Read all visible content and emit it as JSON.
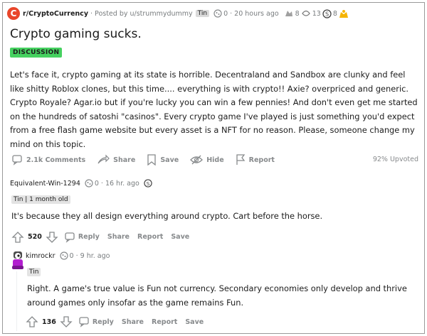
{
  "post": {
    "subreddit": "r/CryptoCurrency",
    "posted_by": "· Posted by u/strummydummy",
    "user_flair": "Tin",
    "moon_count": "0",
    "time": "· 20 hours ago",
    "award1_count": "8",
    "award2_count": "13",
    "award3_count": "8",
    "title": "Crypto gaming sucks.",
    "tag": "DISCUSSION",
    "body": "Let's face it, crypto gaming at its state is horrible. Decentraland and Sandbox are clunky and feel like shitty Roblox clones, but this time.... everything is with crypto!! Axie? overpriced and generic. Crypto Royale? Agar.io but if you're lucky you can win a few pennies! And don't even get me started on the hundreds of satoshi \"casinos\". Every crypto game I've played is just something you'd expect from a free flash game website but every asset is a NFT for no reason. Please, someone change my mind on this topic.",
    "actions": {
      "comments": "2.1k Comments",
      "share": "Share",
      "save": "Save",
      "hide": "Hide",
      "report": "Report",
      "upvoted": "92% Upvoted"
    }
  },
  "comments": [
    {
      "author": "Equivalent-Win-1294",
      "moon_count": "0",
      "time": "· 16 hr. ago",
      "flair": "Tin | 1 month old",
      "text": "It's because they all design everything around crypto. Cart before the horse.",
      "votes": "520",
      "reply": "Reply",
      "share": "Share",
      "report": "Report",
      "save": "Save"
    },
    {
      "author": "kimrockr",
      "moon_count": "0",
      "time": "· 9 hr. ago",
      "flair": "Tin",
      "text": "Right. A game's true value is Fun not currency. Secondary economies only develop and thrive around games only insofar as the game remains Fun.",
      "votes": "136",
      "reply": "Reply",
      "share": "Share",
      "report": "Report",
      "save": "Save"
    }
  ],
  "colors": {
    "subreddit_icon": "#e9462a",
    "tag_bg": "#46d160",
    "muted": "#878a8c"
  }
}
